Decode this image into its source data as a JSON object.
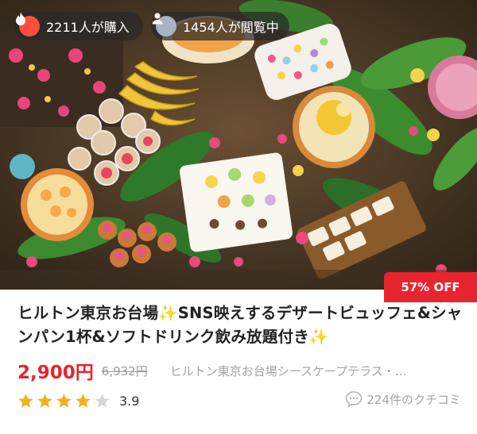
{
  "badges": {
    "purchases": "2211人が購入",
    "viewers": "1454人が閲覧中",
    "discount": "57% OFF"
  },
  "icons": {
    "purchases": "fire-icon",
    "viewers": "person-icon",
    "sparkle": "sparkles-icon",
    "reviews": "chat-bubble-icon"
  },
  "listing": {
    "title_part1": "ヒルトン東京お台場",
    "title_part2": "SNS映えするデザートビュッフェ&シャンパン1杯&ソフトドリンク飲み放題付き",
    "sparkle": "✨",
    "price": "2,900円",
    "original_price": "6,932円",
    "shop": "ヒルトン東京お台場シースケープテラス・ダイ…",
    "rating": "3.9",
    "rating_value": 3.9,
    "rating_max": 5,
    "reviews": "224件のクチコミ"
  },
  "colors": {
    "accent_red": "#e8242e",
    "star_gold": "#f2b01e",
    "star_empty": "#d6d6d6",
    "muted": "#a3a3a3"
  }
}
